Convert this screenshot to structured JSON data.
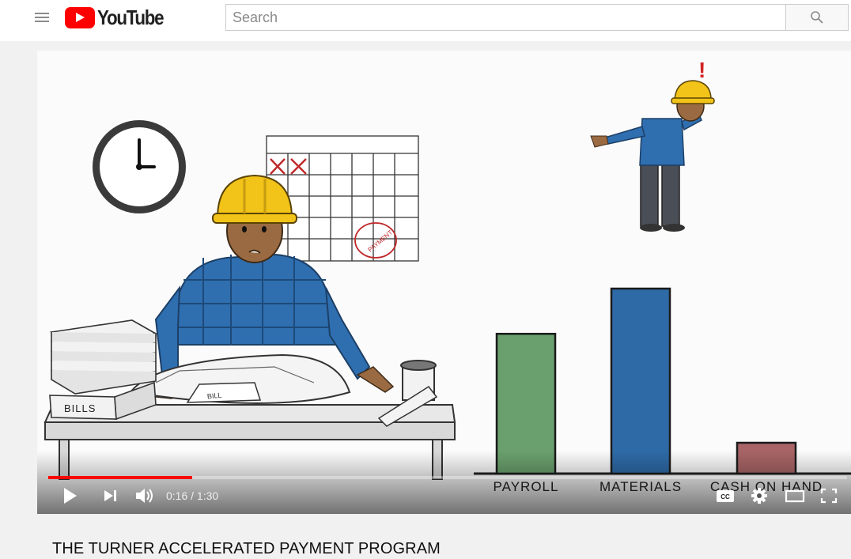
{
  "header": {
    "logo_text": "YouTube",
    "search_placeholder": "Search"
  },
  "video": {
    "chart_labels": [
      "PAYROLL",
      "MATERIALS",
      "CASH ON HAND"
    ],
    "chart_values": [
      0.68,
      0.9,
      0.15
    ],
    "chart_colors": [
      "#6aa06d",
      "#2e6aa6",
      "#a86466"
    ],
    "bills_label": "BILLS",
    "bill_label": "BILL",
    "calendar_note": "PAYMENT",
    "time_display": "0:16 / 1:30",
    "progress_fraction": 0.18
  },
  "page": {
    "title": "THE TURNER ACCELERATED PAYMENT PROGRAM"
  }
}
